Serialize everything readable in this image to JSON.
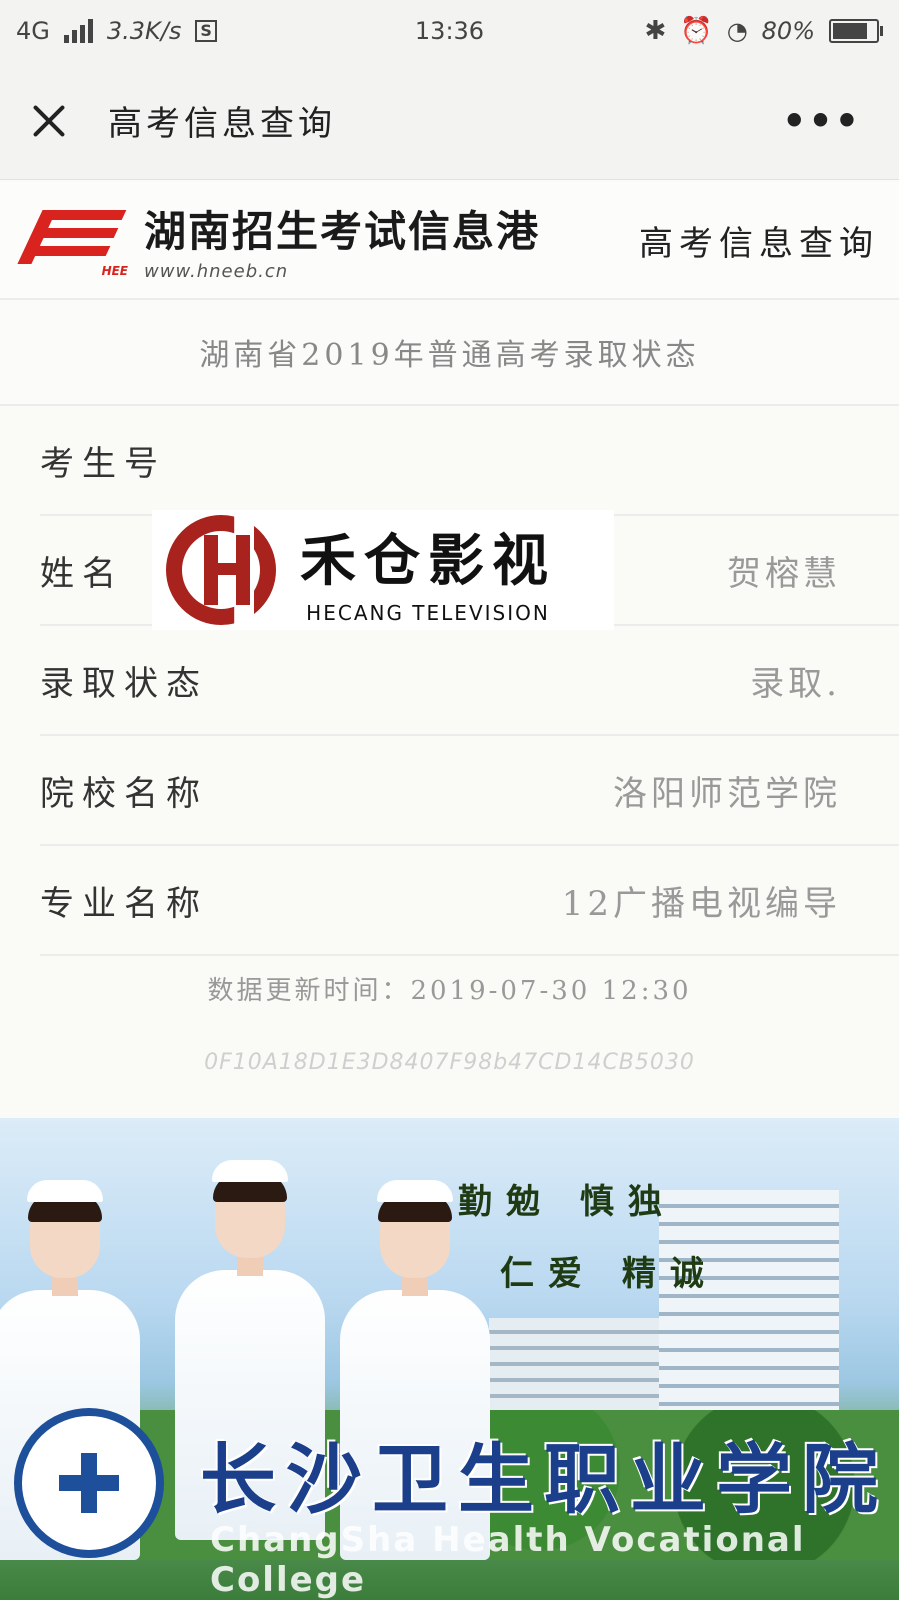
{
  "status_bar": {
    "network": "4G",
    "speed": "3.3K/s",
    "s_badge": "S",
    "time": "13:36",
    "battery": "80%",
    "battery_level": 0.8
  },
  "nav": {
    "title": "高考信息查询",
    "more": "•••"
  },
  "site_header": {
    "logo_text": "HEE",
    "name": "湖南招生考试信息港",
    "url": "www.hneeb.cn",
    "right_title": "高考信息查询"
  },
  "result": {
    "title": "湖南省2019年普通高考录取状态",
    "rows": [
      {
        "label": "考生号",
        "value": ""
      },
      {
        "label": "姓名",
        "value": "贺榕慧"
      },
      {
        "label": "录取状态",
        "value": "录取."
      },
      {
        "label": "院校名称",
        "value": "洛阳师范学院"
      },
      {
        "label": "专业名称",
        "value": "12广播电视编导"
      }
    ],
    "updated": "数据更新时间：2019-07-30 12:30",
    "hash": "0F10A18D1E3D8407F98b47CD14CB5030"
  },
  "watermark": {
    "cn": "禾仓影视",
    "en": "HECANG TELEVISION"
  },
  "banner": {
    "motto_1": "勤勉 慎独",
    "motto_2": "仁爱 精诚",
    "school_name": "长沙卫生职业学院",
    "school_name_en": "ChangSha Health Vocational College"
  }
}
